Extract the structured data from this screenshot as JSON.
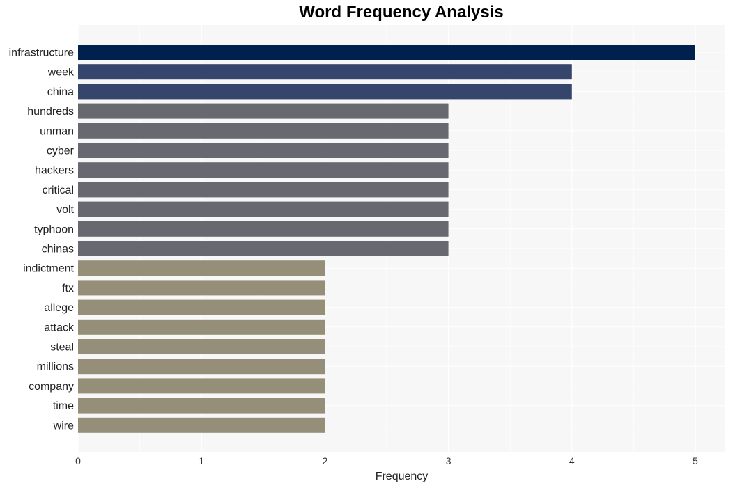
{
  "chart_data": {
    "type": "bar",
    "orientation": "horizontal",
    "title": "Word Frequency Analysis",
    "xlabel": "Frequency",
    "ylabel": "",
    "xlim": [
      0,
      5.25
    ],
    "xticks": [
      0,
      1,
      2,
      3,
      4,
      5
    ],
    "grid": true,
    "legend": "none",
    "categories": [
      "infrastructure",
      "week",
      "china",
      "hundreds",
      "unman",
      "cyber",
      "hackers",
      "critical",
      "volt",
      "typhoon",
      "chinas",
      "indictment",
      "ftx",
      "allege",
      "attack",
      "steal",
      "millions",
      "company",
      "time",
      "wire"
    ],
    "values": [
      5,
      4,
      4,
      3,
      3,
      3,
      3,
      3,
      3,
      3,
      3,
      2,
      2,
      2,
      2,
      2,
      2,
      2,
      2,
      2
    ],
    "colors_by_value": {
      "5": "#00204e",
      "4": "#35456c",
      "3": "#676870",
      "2": "#958f79"
    }
  },
  "colors": {
    "plot_background": "#f7f7f7",
    "grid": "#ffffff"
  }
}
